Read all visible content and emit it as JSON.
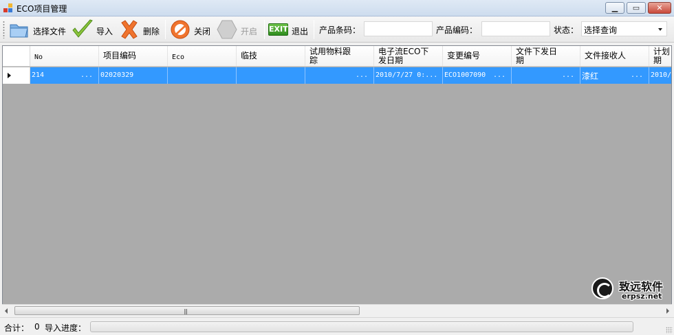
{
  "window": {
    "title": "ECO项目管理"
  },
  "toolbar": {
    "select_file": "选择文件",
    "import": "导入",
    "delete": "删除",
    "close": "关闭",
    "open": "开启",
    "exit": "退出",
    "exit_badge": "EXIT",
    "barcode_label": "产品条码：",
    "barcode_value": "",
    "code_label": "产品编码：",
    "code_value": "",
    "status_label": "状态：",
    "status_value": "选择查询"
  },
  "grid": {
    "columns": [
      "No",
      "项目编码",
      "Eco",
      "临技",
      "试用物料跟\n踪",
      "电子流ECO下\n发日期",
      "变更编号",
      "文件下发日\n期",
      "文件接收人",
      "计划\n期"
    ],
    "rows": [
      {
        "no": "214",
        "project_code": "02020329",
        "eco": "",
        "linji": "",
        "trial_material": "",
        "eco_date": "2010/7/27 0:...",
        "change_no": "ECO1007090",
        "file_date": "",
        "receiver": "漆红",
        "plan_date": "2010/"
      }
    ],
    "ellipsis": "..."
  },
  "watermark": {
    "cn": "致远软件",
    "en": "erpsz.net"
  },
  "status": {
    "total_label": "合计：",
    "total_value": "0",
    "progress_label": "导入进度：",
    "progress": 0
  },
  "colors": {
    "selection": "#3399ff",
    "grid_bg": "#ababab"
  }
}
